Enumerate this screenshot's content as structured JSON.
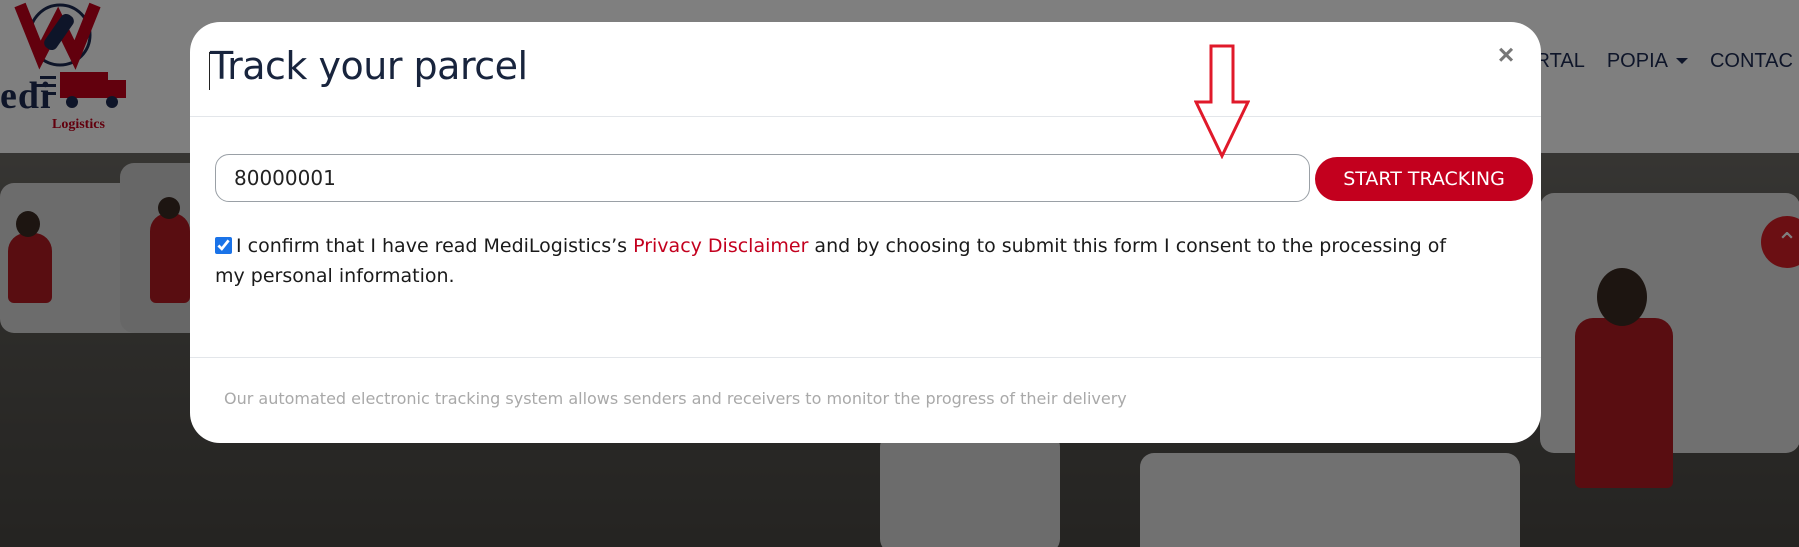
{
  "logo": {
    "word": "edi",
    "subtitle": "Logistics"
  },
  "nav": {
    "items": [
      "ORTAL",
      "POPIA",
      "CONTAC"
    ]
  },
  "modal": {
    "title": "Track your parcel",
    "close_symbol": "×",
    "tracking_input": {
      "value": "80000001"
    },
    "start_button": "START TRACKING",
    "consent": {
      "checked": true,
      "text_before": "I confirm that I have read MediLogistics’s ",
      "link_text": "Privacy Disclaimer",
      "text_after": " and by choosing to submit this form I consent to the processing of my personal information."
    },
    "footer_text": "Our automated electronic tracking system allows senders and receivers to monitor the progress of their delivery"
  },
  "colors": {
    "brand_red": "#c3001e",
    "navy": "#1d2b53",
    "annotation_arrow": "#e0192a"
  },
  "icons": {
    "scroll_top": "double-chevron-up-icon",
    "close": "close-icon",
    "annotation": "down-arrow-icon"
  }
}
